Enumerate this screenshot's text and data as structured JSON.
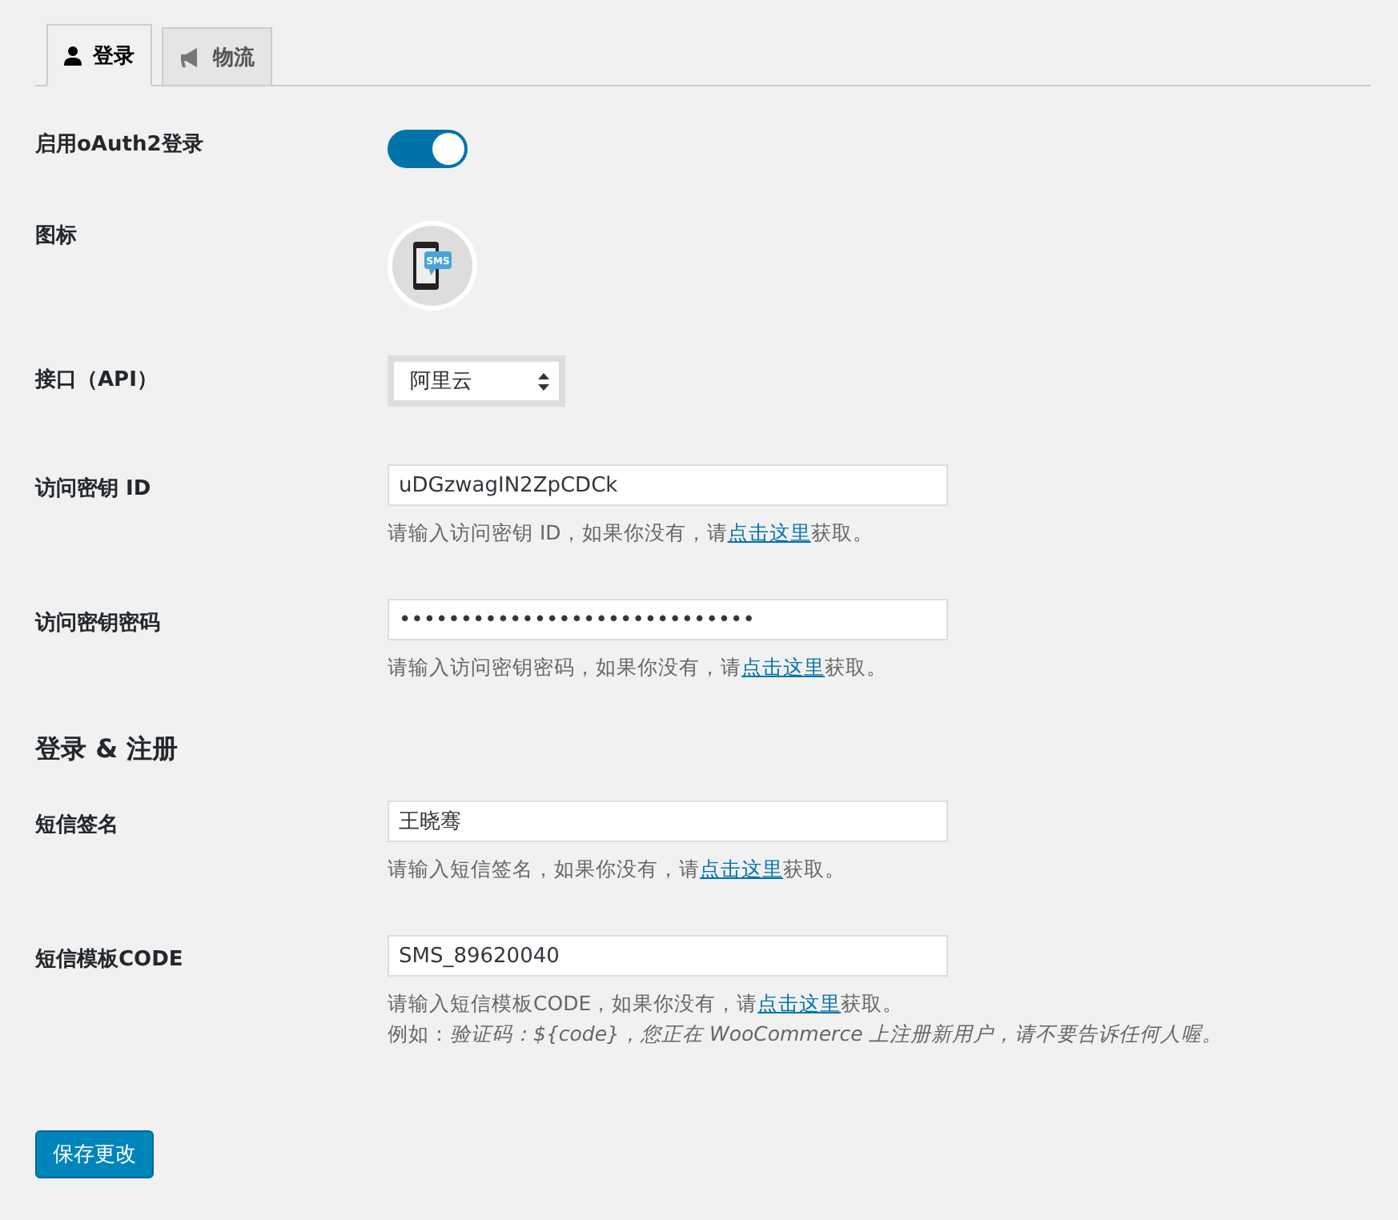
{
  "tabs": [
    {
      "label": "登录",
      "kind": "user",
      "selected": true
    },
    {
      "label": "物流",
      "kind": "megaphone",
      "selected": false
    }
  ],
  "rows": [
    {
      "kind": "toggle",
      "label": "启用oAuth2登录",
      "on": true
    },
    {
      "kind": "icon",
      "label": "图标",
      "icon_text": "SMS"
    },
    {
      "kind": "select",
      "label": "接口（API）",
      "value": "阿里云"
    },
    {
      "kind": "text",
      "label": "访问密钥 ID",
      "value": "uDGzwagIN2ZpCDCk",
      "help": [
        "请输入访问密钥 ID，如果你没有，请",
        "点击这里",
        "获取。"
      ]
    },
    {
      "kind": "password",
      "label": "访问密钥密码",
      "value": "•••••••••••••••••••••••••••••",
      "help": [
        "请输入访问密钥密码，如果你没有，请",
        "点击这里",
        "获取。"
      ]
    },
    {
      "kind": "heading",
      "label": "登录 & 注册"
    },
    {
      "kind": "text",
      "label": "短信签名",
      "value": "王晓骞",
      "help": [
        "请输入短信签名，如果你没有，请",
        "点击这里",
        "获取。"
      ]
    },
    {
      "kind": "text",
      "label": "短信模板CODE",
      "value": "SMS_89620040",
      "help": [
        "请输入短信模板CODE，如果你没有，请",
        "点击这里",
        "获取。"
      ],
      "example": "例如：*验证码：${code}，您正在 WooCommerce 上注册新用户，请不要告诉任何人喔。*"
    }
  ],
  "submit": "保存更改"
}
